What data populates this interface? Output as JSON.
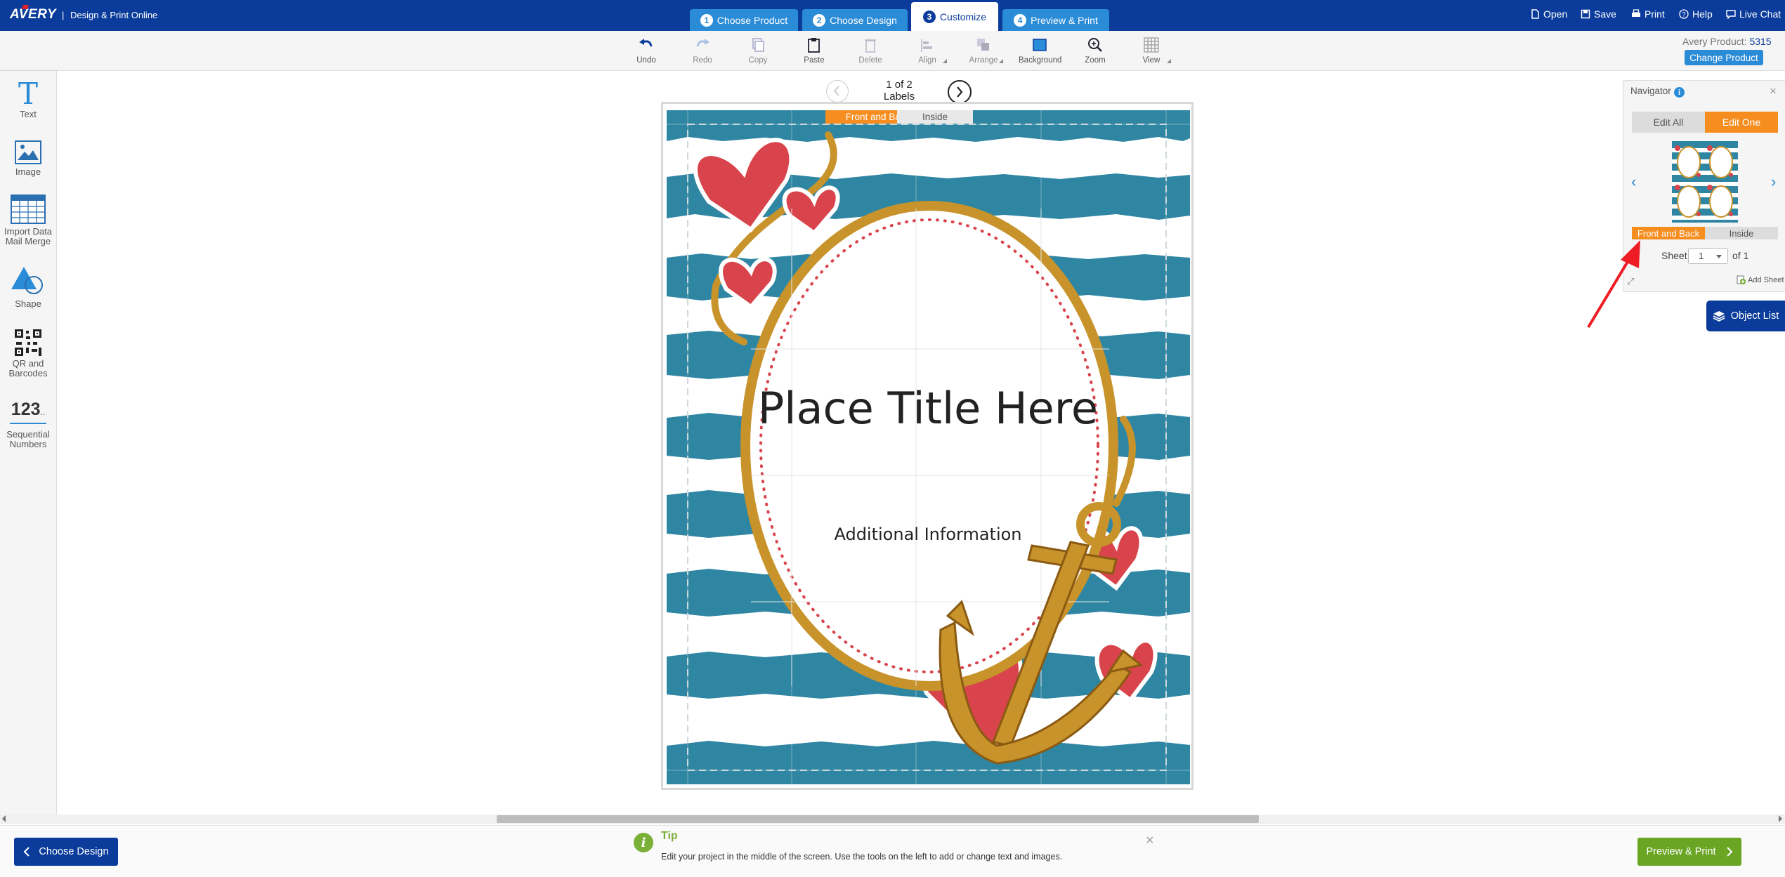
{
  "header": {
    "logo": "AVERY",
    "separator": "|",
    "app_title": "Design & Print Online",
    "steps": [
      {
        "num": "1",
        "label": "Choose Product"
      },
      {
        "num": "2",
        "label": "Choose Design"
      },
      {
        "num": "3",
        "label": "Customize"
      },
      {
        "num": "4",
        "label": "Preview & Print"
      }
    ],
    "actions": {
      "open": "Open",
      "save": "Save",
      "print": "Print",
      "help": "Help",
      "live_chat": "Live Chat"
    }
  },
  "toolbar": {
    "undo": "Undo",
    "redo": "Redo",
    "copy": "Copy",
    "paste": "Paste",
    "delete": "Delete",
    "align": "Align",
    "arrange": "Arrange",
    "background": "Background",
    "zoom": "Zoom",
    "view": "View"
  },
  "product": {
    "label": "Avery Product:",
    "number": "5315",
    "change": "Change Product"
  },
  "sidebar": {
    "text_glyph": "T",
    "text": "Text",
    "image": "Image",
    "import_line1": "Import Data",
    "import_line2": "Mail Merge",
    "shape": "Shape",
    "qr_line1": "QR and",
    "qr_line2": "Barcodes",
    "seq_glyph": "123",
    "seq_dots": "..",
    "seq_line1": "Sequential",
    "seq_line2": "Numbers"
  },
  "canvas": {
    "pager_line1": "1 of 2",
    "pager_line2": "Labels",
    "tab_front": "Front and Back",
    "tab_inside": "Inside",
    "title_text": "Place Title Here",
    "info_text": "Additional Information"
  },
  "navigator": {
    "title": "Navigator",
    "info": "i",
    "close": "×",
    "edit_all": "Edit All",
    "edit_one": "Edit One",
    "front_back": "Front and Back",
    "inside": "Inside",
    "sheet_label": "Sheet",
    "sheet_value": "1",
    "sheet_of": "of 1",
    "add_sheet": "Add Sheet",
    "object_list": "Object List"
  },
  "footer": {
    "back": "Choose Design",
    "tip_title": "Tip",
    "tip_text": "Edit your project in the middle of the screen. Use the tools on the left to add or change text and images.",
    "tip_close": "×",
    "next": "Preview & Print"
  },
  "colors": {
    "nav_blue": "#0b3c9b",
    "step_blue": "#2a8bd7",
    "orange": "#f68d1f",
    "green": "#6aa524",
    "stripe_teal": "#2f86a3",
    "heart_red": "#d9434b",
    "rope_gold": "#c8932b"
  }
}
